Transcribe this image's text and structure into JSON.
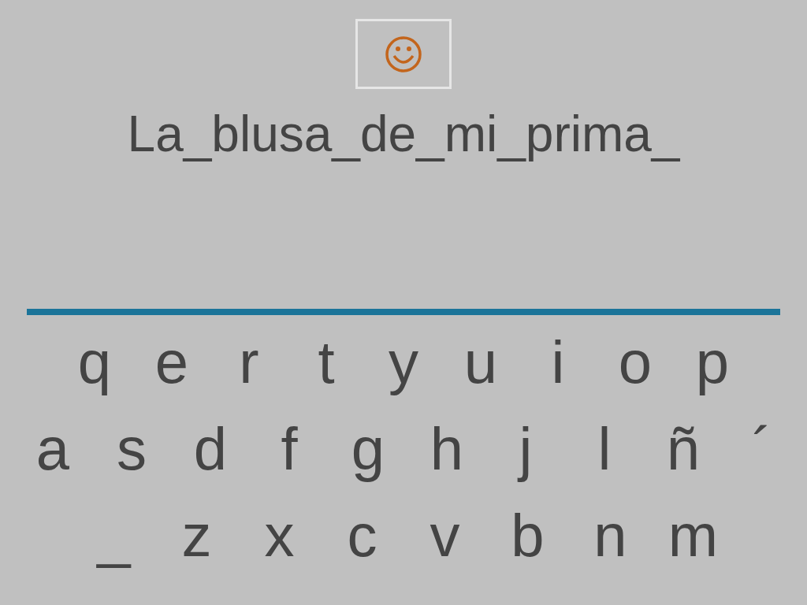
{
  "feedback": {
    "kind": "happy"
  },
  "prompt": {
    "text": "La_blusa_de_mi_prima_"
  },
  "keyboard": {
    "rows": [
      [
        "q",
        "e",
        "r",
        "t",
        "y",
        "u",
        "i",
        "o",
        "p"
      ],
      [
        "a",
        "s",
        "d",
        "f",
        "g",
        "h",
        "j",
        "l",
        "ñ",
        "´"
      ],
      [
        "_",
        "z",
        "x",
        "c",
        "v",
        "b",
        "n",
        "m"
      ]
    ]
  }
}
